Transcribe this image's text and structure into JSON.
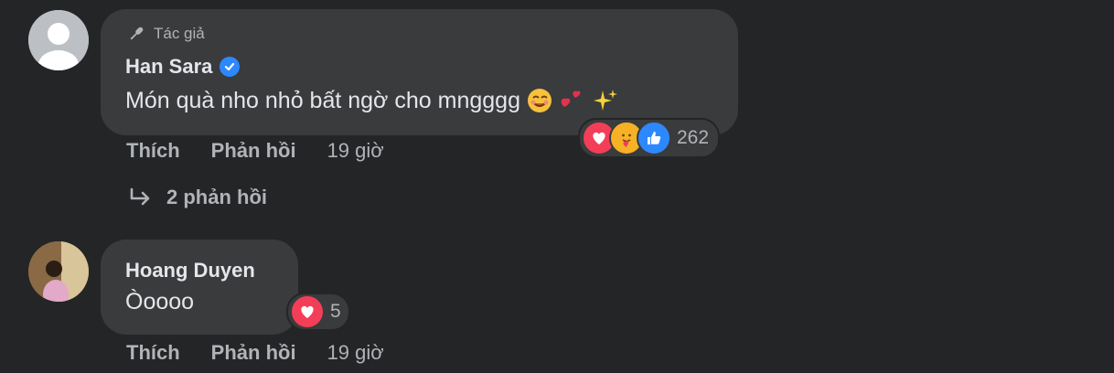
{
  "comments": [
    {
      "author_badge": "Tác giả",
      "author": "Han Sara",
      "verified": true,
      "text": "Món quà nho nhỏ bất ngờ cho mngggg",
      "reaction_count": "262",
      "reactions": [
        "love",
        "care",
        "like"
      ],
      "like_label": "Thích",
      "reply_label": "Phản hồi",
      "time": "19 giờ",
      "replies_link": "2 phản hồi"
    },
    {
      "author": "Hoang Duyen",
      "text": "Òoooo",
      "reaction_count": "5",
      "reactions": [
        "love"
      ],
      "like_label": "Thích",
      "reply_label": "Phản hồi",
      "time": "19 giờ"
    }
  ],
  "colors": {
    "background": "#242526",
    "bubble": "#3a3b3c",
    "text": "#e4e6eb",
    "secondary": "#b0b3b8",
    "verified": "#2d88ff",
    "love": "#f33e58",
    "like": "#2d88ff"
  }
}
